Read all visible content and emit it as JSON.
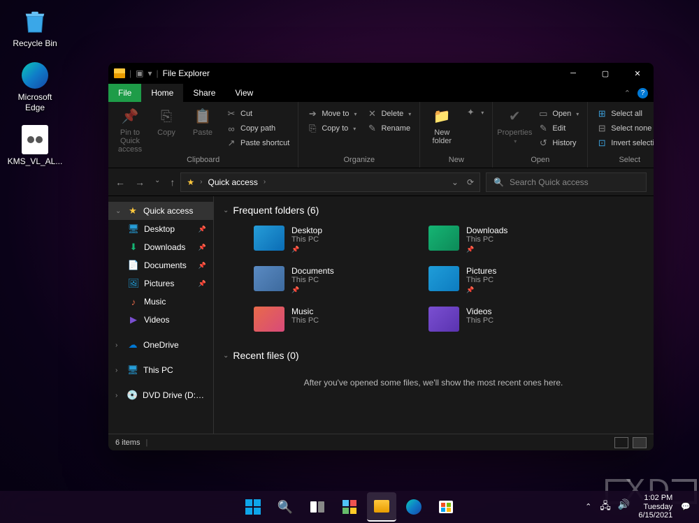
{
  "desktop": {
    "icons": [
      {
        "name": "Recycle Bin"
      },
      {
        "name": "Microsoft Edge"
      },
      {
        "name": "KMS_VL_AL..."
      }
    ]
  },
  "window": {
    "title": "File Explorer",
    "tabs": {
      "file": "File",
      "home": "Home",
      "share": "Share",
      "view": "View"
    },
    "ribbon": {
      "pin": "Pin to Quick\naccess",
      "copy": "Copy",
      "paste": "Paste",
      "cut": "Cut",
      "copypath": "Copy path",
      "pasteshortcut": "Paste shortcut",
      "clipboard_lbl": "Clipboard",
      "moveto": "Move to",
      "copyto": "Copy to",
      "organize_lbl": "Organize",
      "delete": "Delete",
      "rename": "Rename",
      "newfolder": "New\nfolder",
      "new_lbl": "New",
      "properties": "Properties",
      "open": "Open",
      "edit": "Edit",
      "history": "History",
      "open_lbl": "Open",
      "selectall": "Select all",
      "selectnone": "Select none",
      "invert": "Invert selection",
      "select_lbl": "Select"
    },
    "breadcrumb": "Quick access",
    "search_placeholder": "Search Quick access",
    "sidebar": {
      "quick": "Quick access",
      "desktop": "Desktop",
      "downloads": "Downloads",
      "documents": "Documents",
      "pictures": "Pictures",
      "music": "Music",
      "videos": "Videos",
      "onedrive": "OneDrive",
      "thispc": "This PC",
      "dvd": "DVD Drive (D:) CC"
    },
    "content": {
      "frequent_head": "Frequent folders (6)",
      "recent_head": "Recent files (0)",
      "recent_msg": "After you've opened some files, we'll show the most recent ones here.",
      "folders": [
        {
          "name": "Desktop",
          "sub": "This PC",
          "color": "linear-gradient(135deg,#269dd8,#0a6cb5)"
        },
        {
          "name": "Downloads",
          "sub": "This PC",
          "color": "linear-gradient(135deg,#15b574,#0d8a58)"
        },
        {
          "name": "Documents",
          "sub": "This PC",
          "color": "linear-gradient(135deg,#5a8ac2,#3d6a9e)"
        },
        {
          "name": "Pictures",
          "sub": "This PC",
          "color": "linear-gradient(135deg,#1f9dd9,#0d7cc0)"
        },
        {
          "name": "Music",
          "sub": "This PC",
          "color": "linear-gradient(135deg,#e86a4a,#d84a7a)"
        },
        {
          "name": "Videos",
          "sub": "This PC",
          "color": "linear-gradient(135deg,#7a4fd1,#5a33b0)"
        }
      ]
    },
    "status": "6 items"
  },
  "taskbar": {
    "time": "1:02 PM",
    "day": "Tuesday",
    "date": "6/15/2021"
  }
}
